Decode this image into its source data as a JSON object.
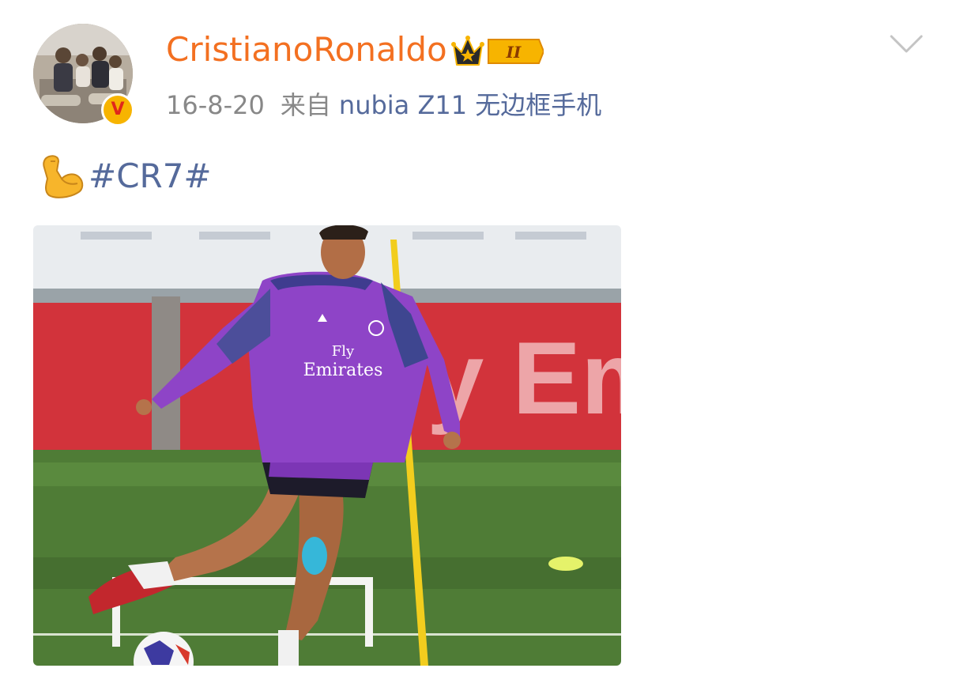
{
  "post": {
    "author": {
      "name": "CristianoRonaldo",
      "verified_badge": "V",
      "vip_level": "II"
    },
    "timestamp": "16-8-20",
    "source_prefix": "来自",
    "device": "nubia Z11 无边框手机",
    "emoji": "flexed-biceps",
    "hashtag": "#CR7#",
    "photo": {
      "banner_text": "y Em",
      "shirt_sponsor_line1": "Fly",
      "shirt_sponsor_line2": "Emirates"
    }
  },
  "colors": {
    "username": "#f37021",
    "link": "#556a9b",
    "meta": "#888888",
    "badge_gold": "#f7b400",
    "badge_red": "#e0271b"
  }
}
